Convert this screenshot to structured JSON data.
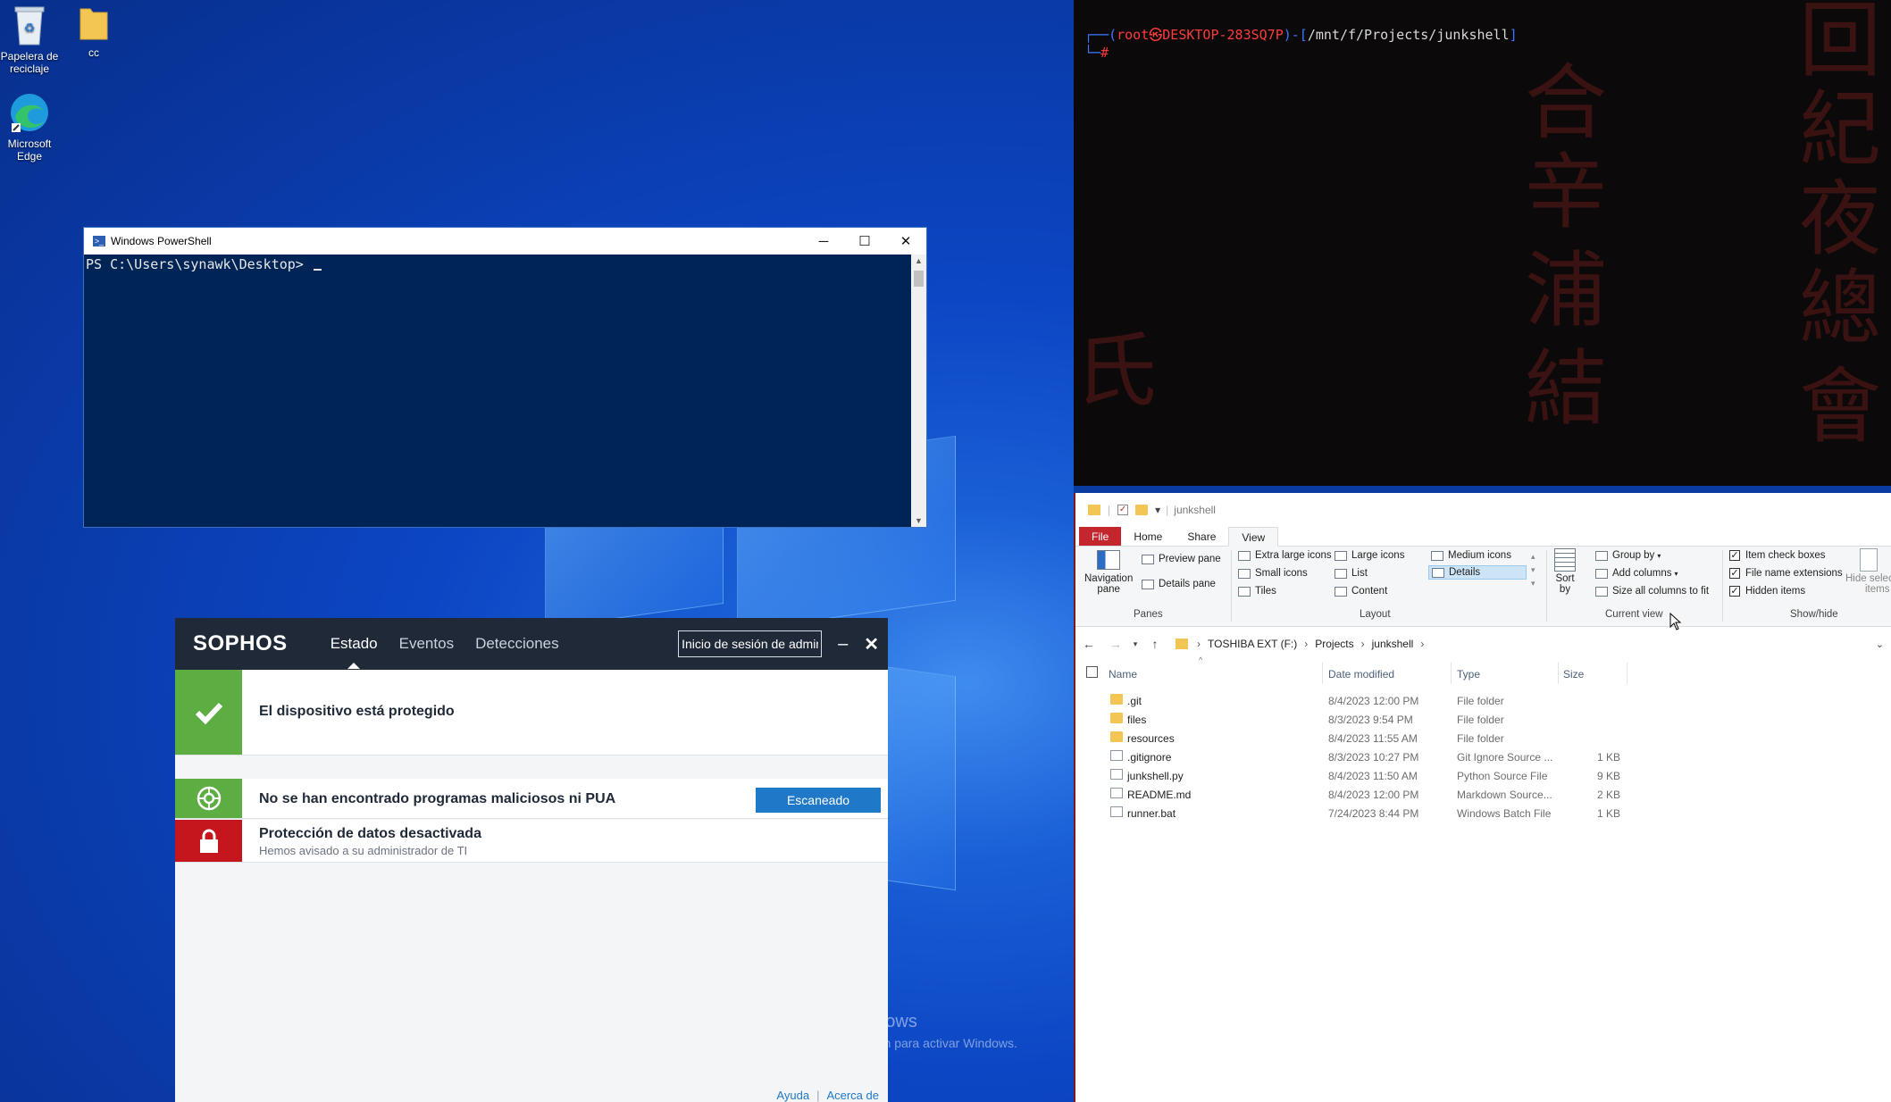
{
  "desktop": {
    "icons": [
      {
        "label": "Papelera de reciclaje"
      },
      {
        "label": "cc"
      },
      {
        "label": "Microsoft Edge"
      }
    ],
    "activation": {
      "title": "Activar Windows",
      "subtitle": "Ve a Configuración para activar Windows."
    }
  },
  "powershell": {
    "title": "Windows PowerShell",
    "prompt": "PS C:\\Users\\synawk\\Desktop> ",
    "controls": {
      "minimize": "─",
      "maximize": "☐",
      "close": "✕"
    }
  },
  "sophos": {
    "logo": "SOPHOS",
    "tabs": [
      {
        "label": "Estado"
      },
      {
        "label": "Eventos"
      },
      {
        "label": "Detecciones"
      }
    ],
    "login_value": "Inicio de sesión de adminis",
    "minimize": "–",
    "close": "✕",
    "status_protected": "El dispositivo está protegido",
    "malware_status": "No se han encontrado programas maliciosos ni PUA",
    "scan_button": "Escaneado",
    "data_protection_title": "Protección de datos desactivada",
    "data_protection_sub": "Hemos avisado a su administrador de TI",
    "footer": {
      "help": "Ayuda",
      "about": "Acerca de"
    },
    "colors": {
      "green": "#5cad42",
      "red": "#c4161c",
      "header": "#1f2937",
      "button": "#1f78c8"
    }
  },
  "terminal": {
    "prompt_user": "root",
    "prompt_at": "㉿",
    "prompt_host": "DESKTOP-283SQ7P",
    "prompt_path": "/mnt/f/Projects/junkshell",
    "prompt_hash": "#",
    "bg_glyphs": [
      "回",
      "紀",
      "夜",
      "總",
      "會",
      "合",
      "辛",
      "浦",
      "結",
      "氏"
    ]
  },
  "explorer": {
    "title": "junkshell",
    "ribbon_tabs": [
      {
        "label": "File"
      },
      {
        "label": "Home"
      },
      {
        "label": "Share"
      },
      {
        "label": "View"
      }
    ],
    "panes": {
      "navigation": "Navigation",
      "navigation2": "pane",
      "preview": "Preview pane",
      "details": "Details pane",
      "group": "Panes"
    },
    "layout": {
      "extra_large": "Extra large icons",
      "large": "Large icons",
      "medium": "Medium icons",
      "small": "Small icons",
      "list": "List",
      "details": "Details",
      "tiles": "Tiles",
      "content": "Content",
      "group": "Layout"
    },
    "current_view": {
      "sort": "Sort",
      "sort2": "by",
      "group_by": "Group by",
      "add_columns": "Add columns",
      "size_all": "Size all columns to fit",
      "group": "Current view"
    },
    "show_hide": {
      "item_check": "Item check boxes",
      "file_ext": "File name extensions",
      "hidden": "Hidden items",
      "hide_selected": "Hide selected",
      "hide_selected2": "items",
      "group": "Show/hide"
    },
    "breadcrumb": [
      {
        "label": "TOSHIBA EXT (F:)"
      },
      {
        "label": "Projects"
      },
      {
        "label": "junkshell"
      }
    ],
    "columns": {
      "name": "Name",
      "date": "Date modified",
      "type": "Type",
      "size": "Size"
    },
    "files": [
      {
        "name": ".git",
        "date": "8/4/2023 12:00 PM",
        "type": "File folder",
        "size": "",
        "kind": "folder"
      },
      {
        "name": "files",
        "date": "8/3/2023 9:54 PM",
        "type": "File folder",
        "size": "",
        "kind": "folder"
      },
      {
        "name": "resources",
        "date": "8/4/2023 11:55 AM",
        "type": "File folder",
        "size": "",
        "kind": "folder"
      },
      {
        "name": ".gitignore",
        "date": "8/3/2023 10:27 PM",
        "type": "Git Ignore Source ...",
        "size": "1 KB",
        "kind": "doc"
      },
      {
        "name": "junkshell.py",
        "date": "8/4/2023 11:50 AM",
        "type": "Python Source File",
        "size": "9 KB",
        "kind": "doc"
      },
      {
        "name": "README.md",
        "date": "8/4/2023 12:00 PM",
        "type": "Markdown Source...",
        "size": "2 KB",
        "kind": "doc"
      },
      {
        "name": "runner.bat",
        "date": "7/24/2023 8:44 PM",
        "type": "Windows Batch File",
        "size": "1 KB",
        "kind": "doc"
      }
    ]
  }
}
